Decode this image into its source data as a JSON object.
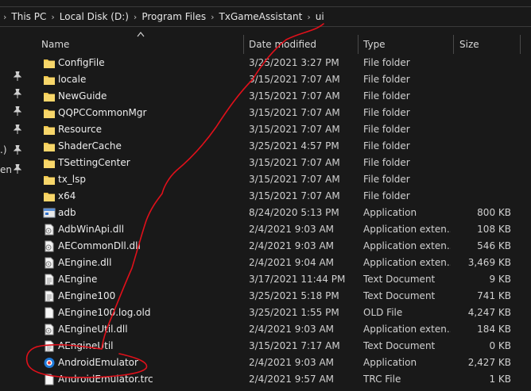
{
  "breadcrumb": [
    "This PC",
    "Local Disk (D:)",
    "Program Files",
    "TxGameAssistant",
    "ui"
  ],
  "nav_fragments": [
    ".)",
    "en"
  ],
  "columns": {
    "name": "Name",
    "date": "Date modified",
    "type": "Type",
    "size": "Size"
  },
  "colors": {
    "folder": "#f3c84b",
    "background": "#191919",
    "annotation": "#e0101a"
  },
  "files": [
    {
      "name": "ConfigFile",
      "date": "3/25/2021 3:27 PM",
      "type": "File folder",
      "size": "",
      "icon": "folder-icon"
    },
    {
      "name": "locale",
      "date": "3/15/2021 7:07 AM",
      "type": "File folder",
      "size": "",
      "icon": "folder-icon"
    },
    {
      "name": "NewGuide",
      "date": "3/15/2021 7:07 AM",
      "type": "File folder",
      "size": "",
      "icon": "folder-icon"
    },
    {
      "name": "QQPCCommonMgr",
      "date": "3/15/2021 7:07 AM",
      "type": "File folder",
      "size": "",
      "icon": "folder-icon"
    },
    {
      "name": "Resource",
      "date": "3/15/2021 7:07 AM",
      "type": "File folder",
      "size": "",
      "icon": "folder-icon"
    },
    {
      "name": "ShaderCache",
      "date": "3/25/2021 4:57 PM",
      "type": "File folder",
      "size": "",
      "icon": "folder-icon"
    },
    {
      "name": "TSettingCenter",
      "date": "3/15/2021 7:07 AM",
      "type": "File folder",
      "size": "",
      "icon": "folder-icon"
    },
    {
      "name": "tx_lsp",
      "date": "3/15/2021 7:07 AM",
      "type": "File folder",
      "size": "",
      "icon": "folder-icon"
    },
    {
      "name": "x64",
      "date": "3/15/2021 7:07 AM",
      "type": "File folder",
      "size": "",
      "icon": "folder-icon"
    },
    {
      "name": "adb",
      "date": "8/24/2020 5:13 PM",
      "type": "Application",
      "size": "800 KB",
      "icon": "app-icon"
    },
    {
      "name": "AdbWinApi.dll",
      "date": "2/4/2021 9:03 AM",
      "type": "Application exten...",
      "size": "108 KB",
      "icon": "dll-icon"
    },
    {
      "name": "AECommonDll.dll",
      "date": "2/4/2021 9:03 AM",
      "type": "Application exten...",
      "size": "546 KB",
      "icon": "dll-icon"
    },
    {
      "name": "AEngine.dll",
      "date": "2/4/2021 9:04 AM",
      "type": "Application exten...",
      "size": "3,469 KB",
      "icon": "dll-icon"
    },
    {
      "name": "AEngine",
      "date": "3/17/2021 11:44 PM",
      "type": "Text Document",
      "size": "9 KB",
      "icon": "text-file-icon"
    },
    {
      "name": "AEngine100",
      "date": "3/25/2021 5:18 PM",
      "type": "Text Document",
      "size": "741 KB",
      "icon": "text-file-icon"
    },
    {
      "name": "AEngine100.log.old",
      "date": "3/25/2021 1:55 PM",
      "type": "OLD File",
      "size": "4,247 KB",
      "icon": "file-icon"
    },
    {
      "name": "AEngineUtil.dll",
      "date": "2/4/2021 9:03 AM",
      "type": "Application exten...",
      "size": "184 KB",
      "icon": "dll-icon"
    },
    {
      "name": "AEngineUtil",
      "date": "3/15/2021 7:17 AM",
      "type": "Text Document",
      "size": "0 KB",
      "icon": "text-file-icon"
    },
    {
      "name": "AndroidEmulator",
      "date": "2/4/2021 9:03 AM",
      "type": "Application",
      "size": "2,427 KB",
      "icon": "emulator-app-icon"
    },
    {
      "name": "AndroidEmulator.trc",
      "date": "2/4/2021 9:57 AM",
      "type": "TRC File",
      "size": "1 KB",
      "icon": "file-icon"
    }
  ]
}
